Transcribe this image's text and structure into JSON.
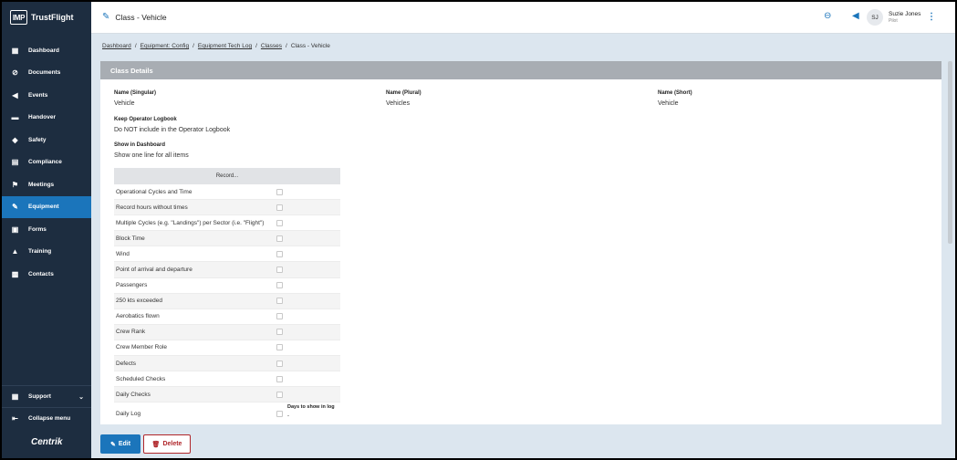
{
  "app": {
    "logo_mark": "IMP",
    "logo_name": "TrustFlight",
    "footer_brand": "Centrik"
  },
  "sidebar": {
    "items": [
      {
        "label": "Dashboard",
        "icon": "dashboard-icon",
        "glyph": "▦"
      },
      {
        "label": "Documents",
        "icon": "paperclip-icon",
        "glyph": "⊘"
      },
      {
        "label": "Events",
        "icon": "megaphone-icon",
        "glyph": "◀"
      },
      {
        "label": "Handover",
        "icon": "truck-icon",
        "glyph": "▬"
      },
      {
        "label": "Safety",
        "icon": "shield-icon",
        "glyph": "◆"
      },
      {
        "label": "Compliance",
        "icon": "clipboard-icon",
        "glyph": "▤"
      },
      {
        "label": "Meetings",
        "icon": "meetings-icon",
        "glyph": "⚑"
      },
      {
        "label": "Equipment",
        "icon": "wrench-icon",
        "glyph": "✎"
      },
      {
        "label": "Forms",
        "icon": "forms-icon",
        "glyph": "▣"
      },
      {
        "label": "Training",
        "icon": "graduation-cap-icon",
        "glyph": "▲"
      },
      {
        "label": "Contacts",
        "icon": "contacts-icon",
        "glyph": "▩"
      }
    ],
    "active": "Equipment",
    "support_label": "Support",
    "collapse_label": "Collapse menu"
  },
  "header": {
    "title": "Class - Vehicle",
    "user_initials": "SJ",
    "user_name": "Suzie Jones",
    "user_role": "Pilot"
  },
  "breadcrumb": [
    "Dashboard",
    "Equipment: Config",
    "Equipment Tech Log",
    "Classes",
    "Class - Vehicle"
  ],
  "card": {
    "header": "Class Details",
    "name_singular_label": "Name (Singular)",
    "name_singular_value": "Vehicle",
    "name_plural_label": "Name (Plural)",
    "name_plural_value": "Vehicles",
    "name_short_label": "Name (Short)",
    "name_short_value": "Vehicle",
    "keep_logbook_label": "Keep Operator Logbook",
    "keep_logbook_value": "Do NOT include in the Operator Logbook",
    "show_dashboard_label": "Show in Dashboard",
    "show_dashboard_value": "Show one line for all items",
    "record_header": "Record...",
    "record_rows": [
      "Operational Cycles and Time",
      "Record hours without times",
      "Multiple Cycles (e.g. \"Landings\") per Sector (i.e. \"Flight\")",
      "Block Time",
      "Wind",
      "Point of arrival and departure",
      "Passengers",
      "250 kts exceeded",
      "Aerobatics flown",
      "Crew Rank",
      "Crew Member Role",
      "Defects",
      "Scheduled Checks",
      "Daily Checks"
    ],
    "daily_log_label": "Daily Log",
    "days_in_log_label": "Days to show in log",
    "days_in_log_value": "-"
  },
  "footer": {
    "edit_label": "Edit",
    "delete_label": "Delete"
  },
  "colors": {
    "sidebar_bg": "#1d2d40",
    "accent": "#1b75bb",
    "danger": "#b0262a"
  }
}
